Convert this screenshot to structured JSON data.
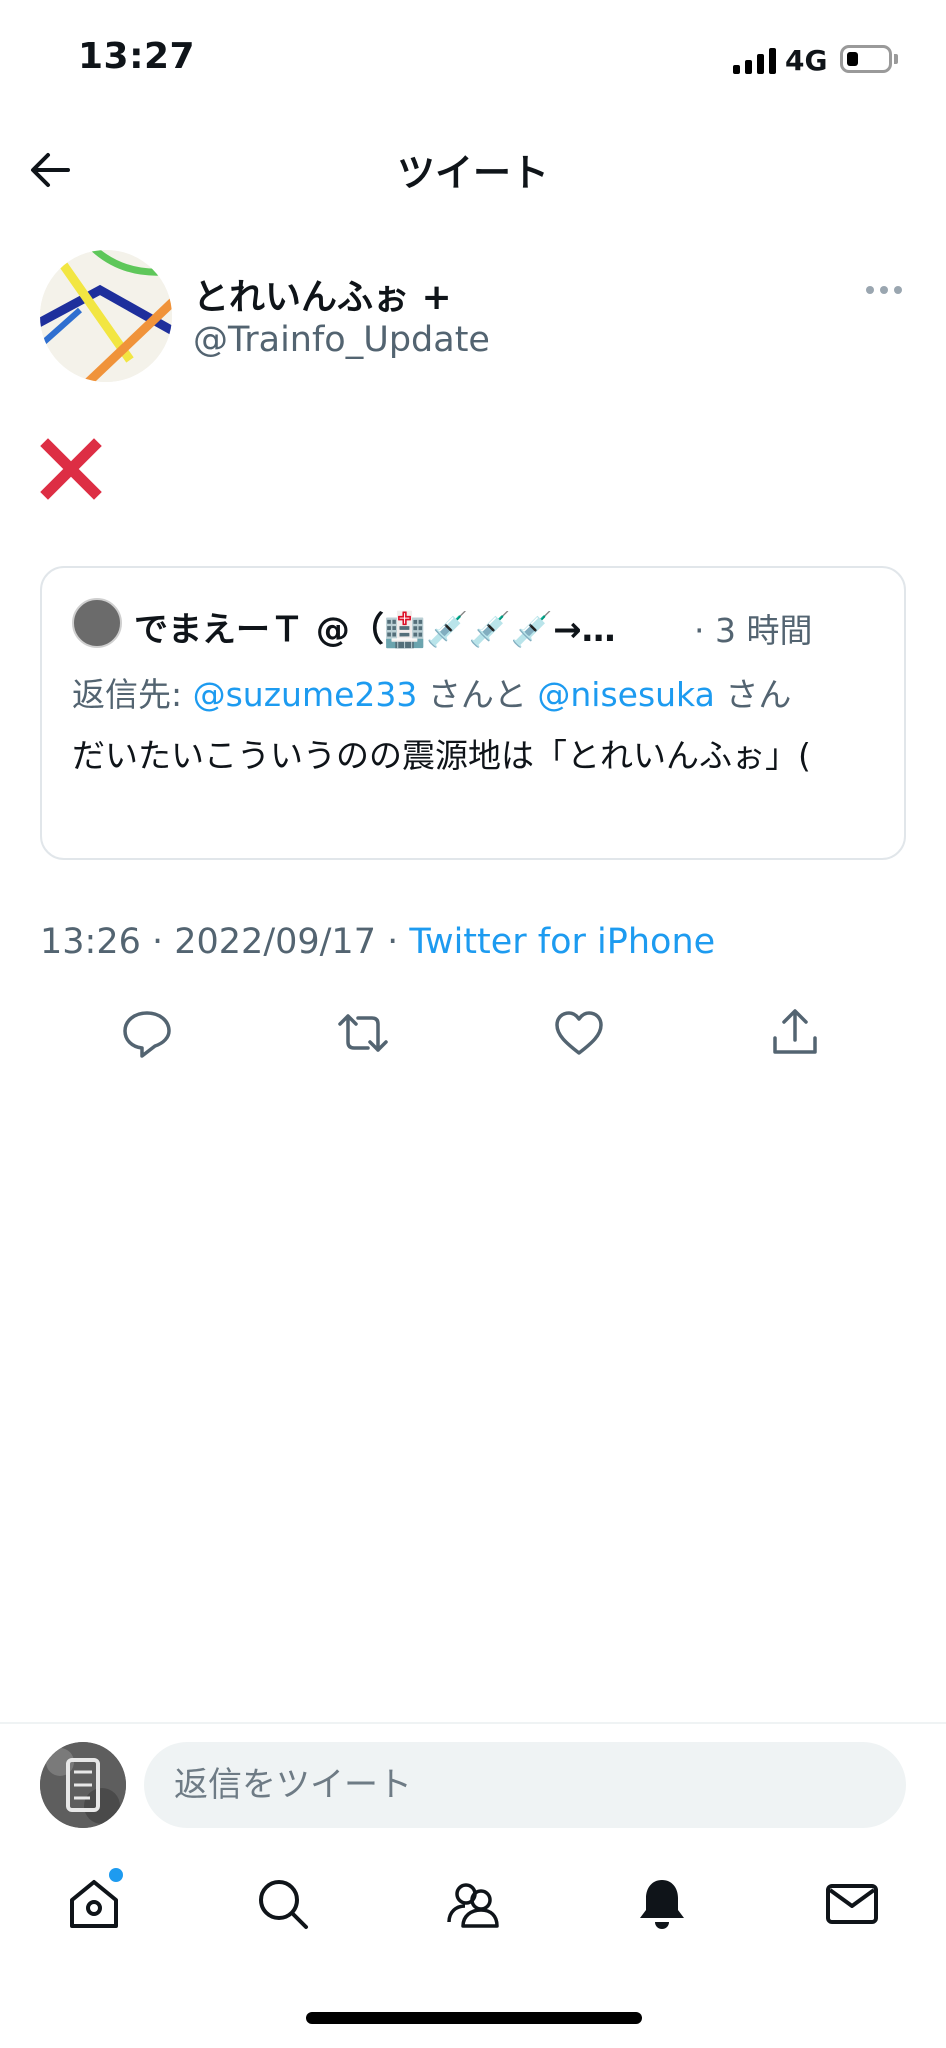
{
  "status_bar": {
    "time": "13:27",
    "network": "4G",
    "battery_level": 0.2
  },
  "header": {
    "title": "ツイート"
  },
  "author": {
    "name": "とれいんふぉ +",
    "handle": "@Trainfo_Update"
  },
  "tweet": {
    "content_icon": "cross-mark-icon"
  },
  "quoted_tweet": {
    "name": "でまえーＴ @（🏥💉💉💉→…",
    "time": "· 3 時間",
    "reply_prefix": "返信先: ",
    "reply_user1": "@suzume233",
    "reply_mid": " さんと ",
    "reply_user2": "@nisesuka",
    "reply_suffix": " さん",
    "text": "だいたいこういうのの震源地は「とれいんふぉ」("
  },
  "meta": {
    "datetime": "13:26 · 2022/09/17 · ",
    "source": "Twitter for iPhone"
  },
  "actions": [
    "reply-icon",
    "retweet-icon",
    "like-icon",
    "share-icon"
  ],
  "reply_bar": {
    "placeholder": "返信をツイート"
  },
  "tab_bar": [
    "home-icon",
    "search-icon",
    "communities-icon",
    "notifications-icon",
    "messages-icon"
  ],
  "colors": {
    "accent": "#1d9bf0",
    "secondary_text": "#536471",
    "cross": "#dd2e44"
  }
}
